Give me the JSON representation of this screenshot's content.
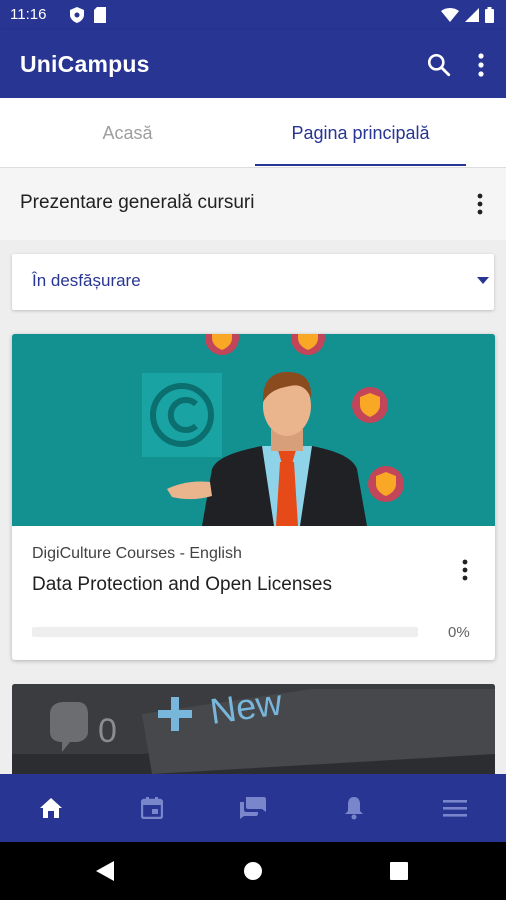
{
  "status_bar": {
    "time": "11:16"
  },
  "app_bar": {
    "title": "UniCampus",
    "search_icon": "search-icon",
    "more_icon": "more-vert-icon"
  },
  "tabs": [
    {
      "label": "Acasă",
      "selected": false
    },
    {
      "label": "Pagina principală",
      "selected": true
    }
  ],
  "section": {
    "title": "Prezentare generală cursuri"
  },
  "filter": {
    "selected": "În desfășurare"
  },
  "courses": [
    {
      "category": "DigiCulture Courses - English",
      "title": "Data Protection and Open Licenses",
      "progress_text": "0%",
      "progress": 0
    }
  ],
  "second_card_image_text": {
    "count": "0",
    "badge": "New"
  },
  "bottom_nav": [
    {
      "icon": "home-icon",
      "active": true
    },
    {
      "icon": "calendar-icon",
      "active": false
    },
    {
      "icon": "messages-icon",
      "active": false
    },
    {
      "icon": "bell-icon",
      "active": false
    },
    {
      "icon": "menu-icon",
      "active": false
    }
  ],
  "colors": {
    "primary": "#283593",
    "card_image_bg": "#139090",
    "tie": "#e64a19",
    "shield": "#f9a825"
  }
}
